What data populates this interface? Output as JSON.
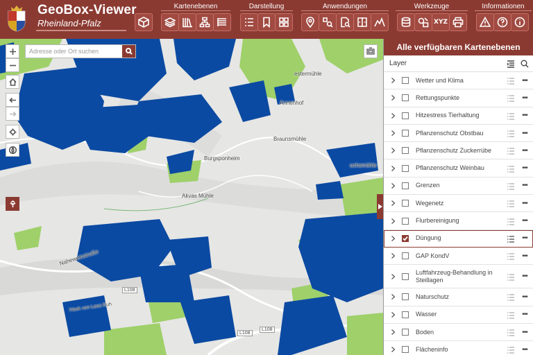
{
  "header": {
    "app_title": "GeoBox-Viewer",
    "app_subtitle": "Rheinland-Pfalz",
    "groups": [
      {
        "label": "Kartenebenen"
      },
      {
        "label": "Darstellung"
      },
      {
        "label": "Anwendungen"
      },
      {
        "label": "Werkzeuge"
      },
      {
        "label": "Informationen"
      }
    ],
    "toolbar_icons": {
      "box": "box-icon",
      "layers": "layers-icon",
      "library": "library-icon",
      "hierarchy": "hierarchy-icon",
      "list": "list-icon",
      "legend": "legend-list-icon",
      "bookmark": "bookmark-icon",
      "grid": "grid-icon",
      "location": "location-pin-icon",
      "find": "find-icon",
      "doc_search": "document-search-icon",
      "swipe": "swipe-icon",
      "profile": "elevation-profile-icon",
      "database": "database-icon",
      "shapes": "shapes-icon",
      "xyz": "XYZ",
      "print": "print-icon",
      "warning": "warning-icon",
      "help": "help-icon",
      "info": "info-icon"
    }
  },
  "map": {
    "search_placeholder": "Adresse oder Ort suchen",
    "labels": {
      "l1": "estermühle",
      "l2": "Annenhof",
      "l3": "Braunsmühle",
      "l4": "Burgsponheim",
      "l5": "uchsmühle",
      "l6": "Akvas Mühle",
      "l7": "Naheweinstraße",
      "l8": "Hauk von Laos Ruh",
      "l9": "L108",
      "l10": "L108",
      "l11": "L108"
    },
    "colors": {
      "blue": "#0b4aa2",
      "green": "#9fd06a",
      "accent": "#8b3a32"
    }
  },
  "panel": {
    "title": "Alle verfügbaren Kartenebenen",
    "layer_header": "Layer",
    "layers": [
      {
        "label": "Wetter und Klima",
        "checked": false
      },
      {
        "label": "Rettungspunkte",
        "checked": false
      },
      {
        "label": "Hitzestress Tierhaltung",
        "checked": false
      },
      {
        "label": "Pflanzenschutz Obstbau",
        "checked": false
      },
      {
        "label": "Pflanzenschutz Zuckerrübe",
        "checked": false
      },
      {
        "label": "Pflanzenschutz Weinbau",
        "checked": false
      },
      {
        "label": "Grenzen",
        "checked": false
      },
      {
        "label": "Wegenetz",
        "checked": false
      },
      {
        "label": "Flurbereinigung",
        "checked": false
      },
      {
        "label": "Düngung",
        "checked": true
      },
      {
        "label": "GAP KondV",
        "checked": false
      },
      {
        "label": "Luftfahrzeug-Behandlung in Steillagen",
        "checked": false
      },
      {
        "label": "Naturschutz",
        "checked": false
      },
      {
        "label": "Wasser",
        "checked": false
      },
      {
        "label": "Boden",
        "checked": false
      },
      {
        "label": "Flächeninfo",
        "checked": false
      }
    ]
  }
}
